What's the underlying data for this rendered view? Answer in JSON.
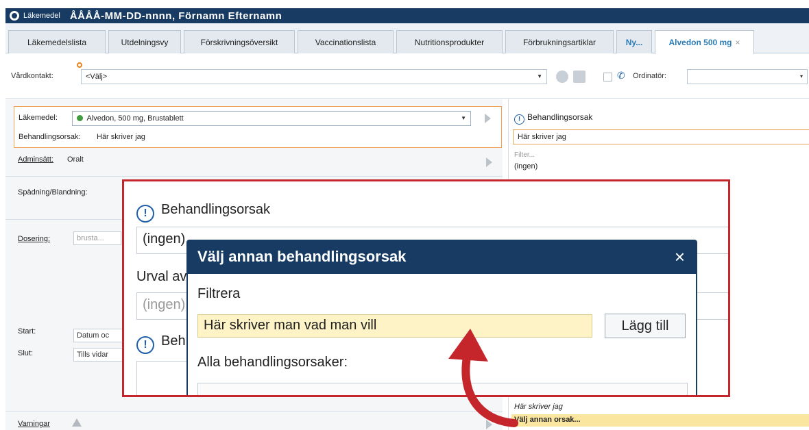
{
  "window": {
    "app_name": "Läkemedel",
    "patient_line": "ÅÅÅÅ-MM-DD-nnnn, Förnamn Efternamn"
  },
  "tabs": [
    {
      "label": "Läkemedelslista"
    },
    {
      "label": "Utdelningsvy"
    },
    {
      "label": "Förskrivningsöversikt"
    },
    {
      "label": "Vaccinationslista"
    },
    {
      "label": "Nutritionsprodukter"
    },
    {
      "label": "Förbrukningsartiklar"
    },
    {
      "label": "Ny..."
    },
    {
      "label": "Alvedon 500 mg",
      "close": "×"
    }
  ],
  "toolbar": {
    "vardkontakt_label": "Vårdkontakt:",
    "vardkontakt_value": "<Välj>",
    "ordinator_label": "Ordinatör:"
  },
  "form": {
    "lakemedel_label": "Läkemedel:",
    "lakemedel_value": "Alvedon, 500 mg, Brustablett",
    "behandlingsorsak_label": "Behandlingsorsak:",
    "behandlingsorsak_value": "Här skriver jag",
    "adminsatt_label": "Adminsätt:",
    "adminsatt_value": "Oralt",
    "spadning_label": "Spädning/Blandning:",
    "dosering_label": "Dosering:",
    "dosering_placeholder": "brusta...",
    "start_label": "Start:",
    "start_value": "Datum oc",
    "slut_label": "Slut:",
    "slut_value": "Tills vidar",
    "varningar_label": "Varningar"
  },
  "right_pane": {
    "heading": "Behandlingsorsak",
    "value": "Här skriver jag",
    "filter_placeholder": "Filter...",
    "option_none": "(ingen)",
    "option_custom": "Här skriver jag",
    "option_other": "Välj annan orsak..."
  },
  "zoom": {
    "title": "Behandlingsorsak",
    "field_value": "(ingen)",
    "urval_label": "Urval av",
    "field2_value": "(ingen)",
    "beh_label": "Beh"
  },
  "dialog": {
    "title": "Välj annan behandlingsorsak",
    "close": "×",
    "filter_label": "Filtrera",
    "filter_value": "Här skriver man vad man vill",
    "add_button": "Lägg till",
    "all_label": "Alla behandlingsorsaker:"
  },
  "colors": {
    "titlebar": "#173b63",
    "accent_tab": "#2a7cb7",
    "focus_border": "#f0a358",
    "highlight": "#fbe6a0",
    "callout_border": "#c4262b"
  },
  "icons": [
    "app-logo-icon",
    "required-dot-icon",
    "dropdown-arrow-icon",
    "print-icon",
    "phone-icon",
    "play-icon",
    "info-icon",
    "warning-icon",
    "close-icon",
    "curved-arrow-icon"
  ]
}
